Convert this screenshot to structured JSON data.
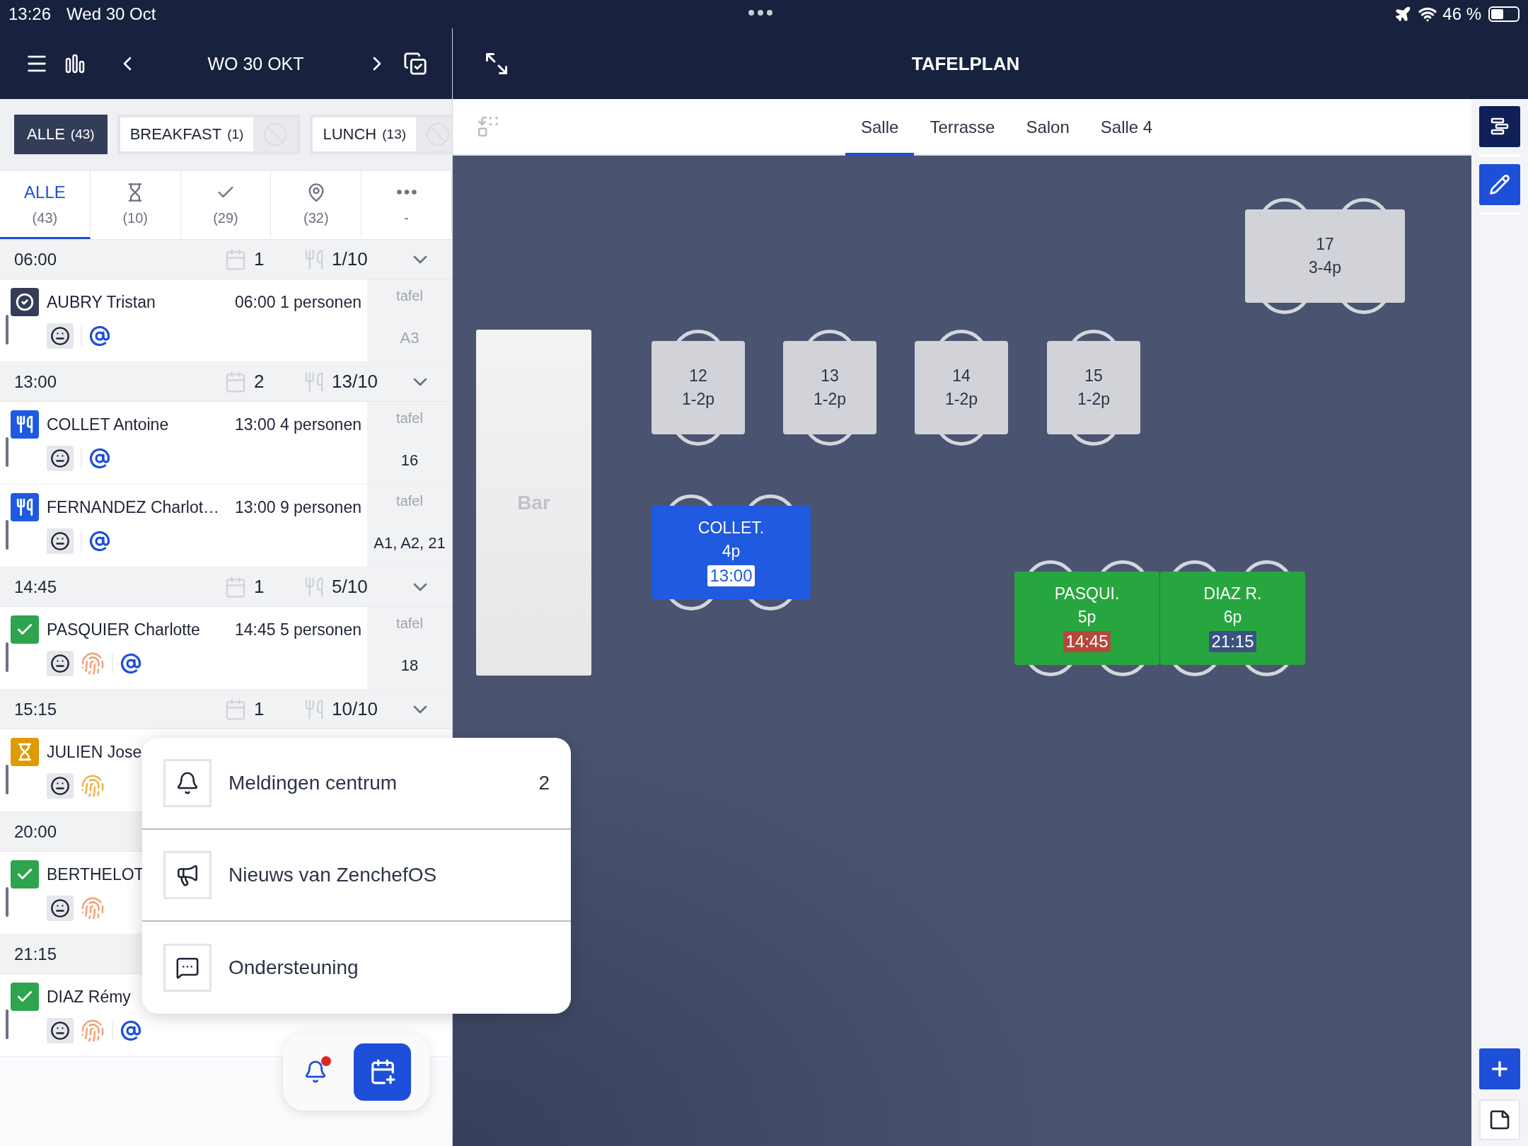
{
  "status_bar": {
    "time": "13:26",
    "date": "Wed 30 Oct",
    "battery": "46 %"
  },
  "sidebar_header": {
    "date": "WO 30 OKT"
  },
  "services": [
    {
      "label": "ALLE",
      "count": "(43)",
      "selected": true
    },
    {
      "label": "BREAKFAST",
      "count": "(1)",
      "selected": false
    },
    {
      "label": "LUNCH",
      "count": "(13)",
      "selected": false
    }
  ],
  "filters": [
    {
      "kind": "all",
      "label": "ALLE",
      "count": "(43)",
      "selected": true
    },
    {
      "kind": "waiting",
      "count": "(10)",
      "selected": false
    },
    {
      "kind": "seated",
      "count": "(29)",
      "selected": false
    },
    {
      "kind": "placed",
      "count": "(32)",
      "selected": false
    },
    {
      "kind": "more",
      "count": "-",
      "selected": false
    }
  ],
  "groups": [
    {
      "time": "06:00",
      "bookings": "1",
      "covers": "1/10",
      "reservations": [
        {
          "kind": "done",
          "name": "AUBRY Tristan",
          "time": "06:00",
          "party": "1 personen",
          "fingerprint": false,
          "email": true,
          "table_label": "tafel",
          "table": "A3"
        }
      ]
    },
    {
      "time": "13:00",
      "bookings": "2",
      "covers": "13/10",
      "reservations": [
        {
          "kind": "seated",
          "name": "COLLET Antoine",
          "time": "13:00",
          "party": "4 personen",
          "fingerprint": false,
          "email": true,
          "table_label": "tafel",
          "table": "16"
        },
        {
          "kind": "seated",
          "name": "FERNANDEZ Charlot…",
          "time": "13:00",
          "party": "9 personen",
          "fingerprint": false,
          "email": true,
          "table_label": "tafel",
          "table": "A1, A2, 21"
        }
      ]
    },
    {
      "time": "14:45",
      "bookings": "1",
      "covers": "5/10",
      "reservations": [
        {
          "kind": "arrived",
          "name": "PASQUIER Charlotte",
          "time": "14:45",
          "party": "5 personen",
          "fingerprint": true,
          "fingerprint_pending": false,
          "email": true,
          "table_label": "tafel",
          "table": "18"
        }
      ]
    },
    {
      "time": "15:15",
      "bookings": "1",
      "covers": "10/10",
      "reservations": [
        {
          "kind": "waiting",
          "name": "JULIEN Jose",
          "fingerprint": true,
          "fingerprint_pending": true
        }
      ]
    },
    {
      "time": "20:00",
      "reservations": [
        {
          "kind": "arrived",
          "name": "BERTHELOT",
          "fingerprint": true,
          "fingerprint_pending": false
        }
      ]
    },
    {
      "time": "21:15",
      "reservations": [
        {
          "kind": "arrived",
          "name": "DIAZ Rémy",
          "fingerprint": true,
          "fingerprint_pending": false,
          "email": true
        }
      ]
    }
  ],
  "menu": {
    "items": [
      {
        "kind": "notifications",
        "label": "Meldingen centrum",
        "count": "2"
      },
      {
        "kind": "news",
        "label": "Nieuws van ZenchefOS"
      },
      {
        "kind": "support",
        "label": "Ondersteuning"
      }
    ]
  },
  "fab": {
    "unread": true
  },
  "floorplan": {
    "title": "TAFELPLAN",
    "rooms": [
      {
        "label": "Salle",
        "selected": true
      },
      {
        "label": "Terrasse",
        "selected": false
      },
      {
        "label": "Salon",
        "selected": false
      },
      {
        "label": "Salle 4",
        "selected": false
      }
    ],
    "bar": {
      "label": "Bar"
    },
    "tables": [
      {
        "kind": "free",
        "number": "17",
        "capacity": "3-4p"
      },
      {
        "kind": "free",
        "number": "12",
        "capacity": "1-2p"
      },
      {
        "kind": "free",
        "number": "13",
        "capacity": "1-2p"
      },
      {
        "kind": "free",
        "number": "14",
        "capacity": "1-2p"
      },
      {
        "kind": "free",
        "number": "15",
        "capacity": "1-2p"
      },
      {
        "kind": "booked",
        "color": "#1f5ae0",
        "name": "COLLET.",
        "covers": "4p",
        "time": {
          "text": "13:00",
          "color": "#ffffff"
        }
      },
      {
        "kind": "booked",
        "color": "#27a63f",
        "name": "PASQUI.",
        "covers": "5p",
        "time": {
          "text": "14:45",
          "color": "#b4493a"
        }
      },
      {
        "kind": "booked",
        "color": "#27a63f",
        "name": "DIAZ R.",
        "covers": "6p",
        "time": {
          "text": "21:15",
          "color": "#3b5282"
        }
      }
    ]
  }
}
